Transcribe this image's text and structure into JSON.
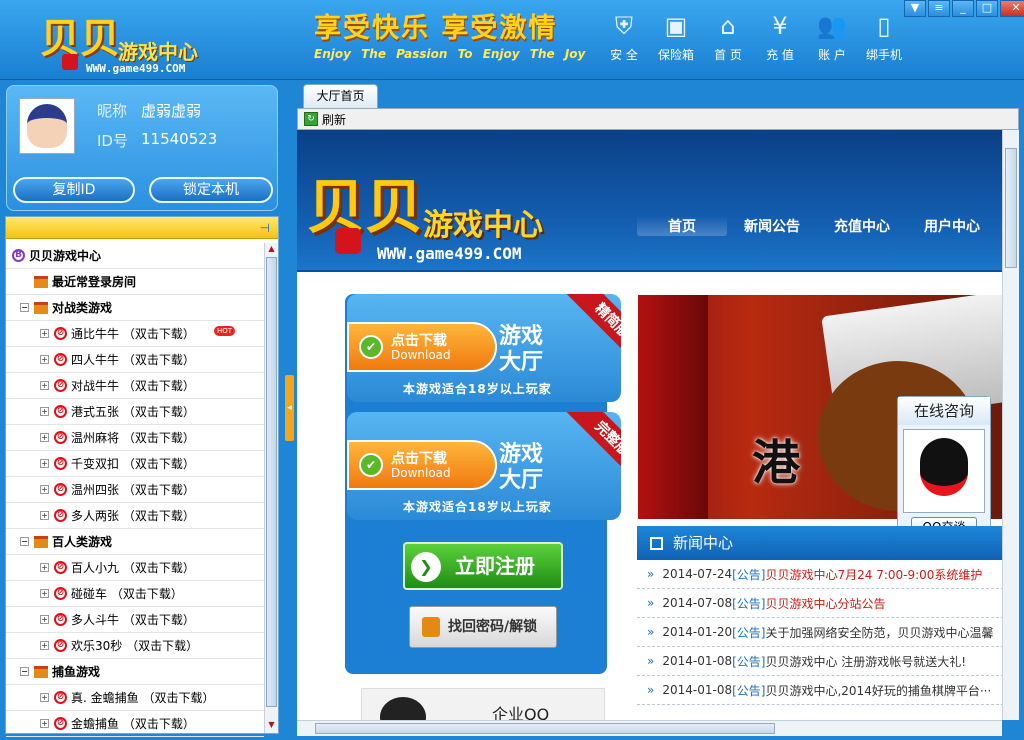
{
  "app": {
    "logo_big": "贝贝",
    "logo_cn": "游戏中心",
    "logo_url": "WWW.game499.COM",
    "slogan_cn": "享受快乐 享受激情",
    "slogan_en": "Enjoy The Passion To Enjoy The Joy"
  },
  "topnav": [
    {
      "label": "安 全",
      "icon": "shield-icon"
    },
    {
      "label": "保险箱",
      "icon": "safe-icon"
    },
    {
      "label": "首 页",
      "icon": "home-icon"
    },
    {
      "label": "充 值",
      "icon": "yen-icon"
    },
    {
      "label": "账 户",
      "icon": "users-icon"
    },
    {
      "label": "绑手机",
      "icon": "phone-icon"
    }
  ],
  "profile": {
    "nick_label": "昵称",
    "nick": "虚弱虚弱",
    "id_label": "ID号",
    "id": "11540523",
    "copy_btn": "复制ID",
    "lock_btn": "锁定本机"
  },
  "tree": {
    "root": "贝贝游戏中心",
    "recent": "最近常登录房间",
    "groups": [
      {
        "name": "对战类游戏",
        "items": [
          "通比牛牛 （双击下载）",
          "四人牛牛 （双击下载）",
          "对战牛牛 （双击下载）",
          "港式五张 （双击下载）",
          "温州麻将 （双击下载）",
          "千变双扣 （双击下载）",
          "温州四张 （双击下载）",
          "多人两张 （双击下载）"
        ]
      },
      {
        "name": "百人类游戏",
        "items": [
          "百人小九 （双击下载）",
          "碰碰车 （双击下载）",
          "多人斗牛 （双击下载）",
          "欢乐30秒 （双击下载）"
        ]
      },
      {
        "name": "捕鱼游戏",
        "items": [
          "真. 金蟾捕鱼 （双击下载）",
          "金蟾捕鱼 （双击下载）"
        ]
      }
    ],
    "hot_badge": "HOT"
  },
  "tab": {
    "label": "大厅首页"
  },
  "toolbar": {
    "refresh": "刷新"
  },
  "web": {
    "logo_big": "贝贝",
    "logo_cn": "游戏中心",
    "logo_url": "WWW.game499.COM",
    "nav": [
      "首页",
      "新闻公告",
      "充值中心",
      "用户中心"
    ],
    "dl_simple": {
      "d1": "点击下载",
      "d2": "Download",
      "t1": "游戏",
      "t2": "大厅",
      "note": "本游戏适合18岁以上玩家",
      "ribbon": "精简版"
    },
    "dl_full": {
      "d1": "点击下载",
      "d2": "Download",
      "t1": "游戏",
      "t2": "大厅",
      "note": "本游戏适合18岁以上玩家",
      "ribbon": "完整版"
    },
    "register": "立即注册",
    "recover": "找回密码/解锁",
    "qq_promo": "企业QQ",
    "banner_text": "港",
    "qq_widget": {
      "title": "在线咨询",
      "btn": "QQ交谈"
    },
    "news_title": "新闻中心",
    "news": [
      {
        "date": "2014-07-24",
        "cat": "[公告]",
        "title": "贝贝游戏中心7月24 7:00-9:00系统维护",
        "red": true
      },
      {
        "date": "2014-07-08",
        "cat": "[公告]",
        "title": "贝贝游戏中心分站公告",
        "red": true
      },
      {
        "date": "2014-01-20",
        "cat": "[公告]",
        "title": "关于加强网络安全防范，贝贝游戏中心温馨",
        "red": false
      },
      {
        "date": "2014-01-08",
        "cat": "[公告]",
        "title": "贝贝游戏中心 注册游戏帐号就送大礼!",
        "red": false
      },
      {
        "date": "2014-01-08",
        "cat": "[公告]",
        "title": "贝贝游戏中心,2014好玩的捕鱼棋牌平台···",
        "red": false
      }
    ]
  },
  "colors": {
    "accent": "#1f86d6",
    "highlight": "#ffd21f",
    "news_red": "#d41a10"
  }
}
